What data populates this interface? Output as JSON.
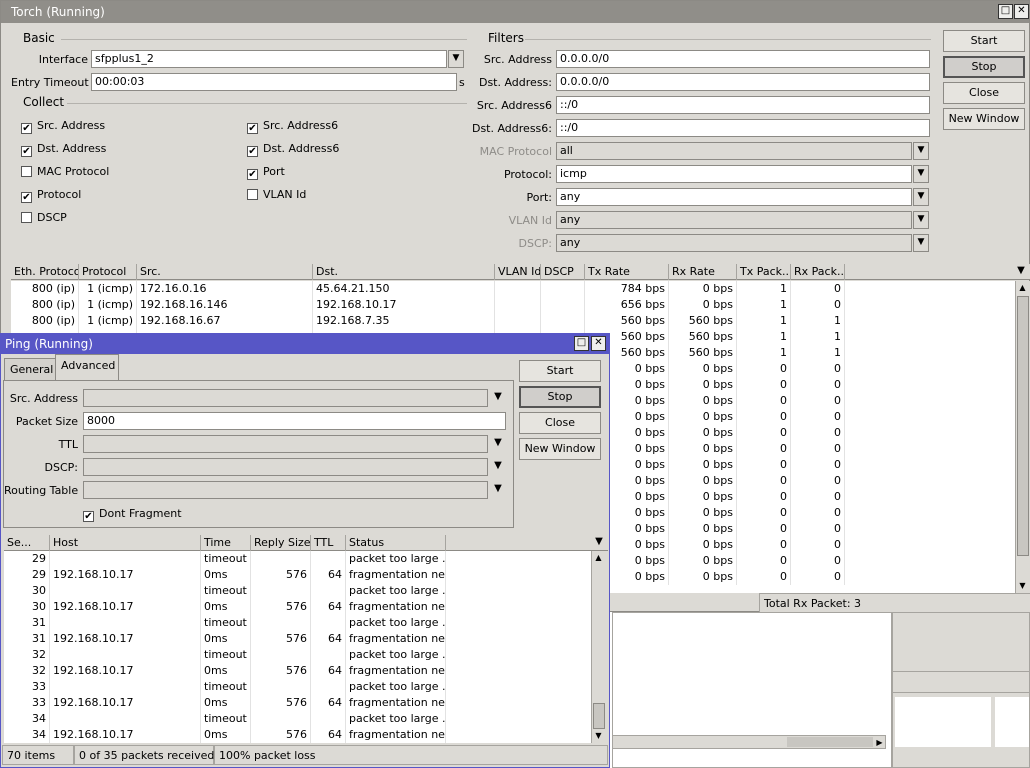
{
  "torch": {
    "title": "Torch (Running)",
    "maximize_glyph": "□",
    "close_glyph": "✕",
    "basic_label": "Basic",
    "interface_label": "Interface",
    "interface_value": "sfpplus1_2",
    "entry_timeout_label": "Entry Timeout",
    "entry_timeout_value": "00:00:03",
    "timeout_unit": "s",
    "collect_label": "Collect",
    "collect": [
      {
        "label": "Src. Address",
        "checked": true
      },
      {
        "label": "Dst. Address",
        "checked": true
      },
      {
        "label": "MAC Protocol",
        "checked": false
      },
      {
        "label": "Protocol",
        "checked": true
      },
      {
        "label": "DSCP",
        "checked": false
      },
      {
        "label": "Src. Address6",
        "checked": true
      },
      {
        "label": "Dst. Address6",
        "checked": true
      },
      {
        "label": "Port",
        "checked": true
      },
      {
        "label": "VLAN Id",
        "checked": false
      }
    ],
    "filters_label": "Filters",
    "filters": [
      {
        "label": "Src. Address",
        "value": "0.0.0.0/0"
      },
      {
        "label": "Dst. Address:",
        "value": "0.0.0.0/0"
      },
      {
        "label": "Src. Address6",
        "value": "::/0"
      },
      {
        "label": "Dst. Address6:",
        "value": "::/0"
      },
      {
        "label": "MAC Protocol",
        "value": "all"
      },
      {
        "label": "Protocol:",
        "value": "icmp"
      },
      {
        "label": "Port:",
        "value": "any"
      },
      {
        "label": "VLAN Id",
        "value": "any"
      },
      {
        "label": "DSCP:",
        "value": "any"
      }
    ],
    "buttons": {
      "start": "Start",
      "stop": "Stop",
      "close": "Close",
      "new_window": "New Window"
    },
    "columns": [
      "Eth. Protocol",
      "Protocol",
      "Src.",
      "Dst.",
      "VLAN Id",
      "DSCP",
      "Tx Rate",
      "Rx Rate",
      "Tx Pack...",
      "Rx Pack..."
    ],
    "rows": [
      [
        "800 (ip)",
        "1 (icmp)",
        "172.16.0.16",
        "45.64.21.150",
        "",
        "",
        "784 bps",
        "0 bps",
        "1",
        "0"
      ],
      [
        "800 (ip)",
        "1 (icmp)",
        "192.168.16.146",
        "192.168.10.17",
        "",
        "",
        "656 bps",
        "0 bps",
        "1",
        "0"
      ],
      [
        "800 (ip)",
        "1 (icmp)",
        "192.168.16.67",
        "192.168.7.35",
        "",
        "",
        "560 bps",
        "560 bps",
        "1",
        "1"
      ],
      [
        "",
        "",
        "",
        "",
        "",
        "",
        "560 bps",
        "560 bps",
        "1",
        "1"
      ],
      [
        "",
        "",
        "",
        "",
        "",
        "",
        "560 bps",
        "560 bps",
        "1",
        "1"
      ],
      [
        "",
        "",
        "",
        "",
        "",
        "",
        "0 bps",
        "0 bps",
        "0",
        "0"
      ],
      [
        "",
        "",
        "",
        "",
        "",
        "",
        "0 bps",
        "0 bps",
        "0",
        "0"
      ],
      [
        "",
        "",
        "",
        "",
        "",
        "",
        "0 bps",
        "0 bps",
        "0",
        "0"
      ],
      [
        "",
        "",
        "",
        "",
        "",
        "",
        "0 bps",
        "0 bps",
        "0",
        "0"
      ],
      [
        "",
        "",
        "",
        "",
        "",
        "",
        "0 bps",
        "0 bps",
        "0",
        "0"
      ],
      [
        "",
        "",
        "",
        "",
        "",
        "",
        "0 bps",
        "0 bps",
        "0",
        "0"
      ],
      [
        "",
        "",
        "",
        "",
        "",
        "",
        "0 bps",
        "0 bps",
        "0",
        "0"
      ],
      [
        "",
        "",
        "",
        "",
        "",
        "",
        "0 bps",
        "0 bps",
        "0",
        "0"
      ],
      [
        "",
        "",
        "",
        "",
        "",
        "",
        "0 bps",
        "0 bps",
        "0",
        "0"
      ],
      [
        "",
        "",
        "",
        "",
        "",
        "",
        "0 bps",
        "0 bps",
        "0",
        "0"
      ],
      [
        "",
        "",
        "",
        "",
        "",
        "",
        "0 bps",
        "0 bps",
        "0",
        "0"
      ],
      [
        "",
        "",
        "",
        "",
        "",
        "",
        "0 bps",
        "0 bps",
        "0",
        "0"
      ],
      [
        "",
        "",
        "",
        "",
        "",
        "",
        "0 bps",
        "0 bps",
        "0",
        "0"
      ],
      [
        "",
        "",
        "",
        "",
        "",
        "",
        "0 bps",
        "0 bps",
        "0",
        "0"
      ]
    ],
    "total_rx": "Total Rx Packet: 3"
  },
  "ping": {
    "title": "Ping (Running)",
    "maximize_glyph": "□",
    "close_glyph": "✕",
    "tabs": [
      "General",
      "Advanced"
    ],
    "active_tab": "Advanced",
    "src_address_label": "Src. Address",
    "src_address_value": "",
    "packet_size_label": "Packet Size",
    "packet_size_value": "8000",
    "ttl_label": "TTL",
    "ttl_value": "",
    "dscp_label": "DSCP:",
    "dscp_value": "",
    "routing_table_label": "Routing Table",
    "routing_table_value": "",
    "dont_fragment_label": "Dont Fragment",
    "dont_fragment_checked": true,
    "buttons": {
      "start": "Start",
      "stop": "Stop",
      "close": "Close",
      "new_window": "New Window"
    },
    "columns": [
      "Se...",
      "Host",
      "Time",
      "Reply Size",
      "TTL",
      "Status"
    ],
    "rows": [
      [
        "29",
        "",
        "timeout",
        "",
        "",
        "packet too large ..."
      ],
      [
        "29",
        "192.168.10.17",
        "0ms",
        "576",
        "64",
        "fragmentation ne..."
      ],
      [
        "30",
        "",
        "timeout",
        "",
        "",
        "packet too large ..."
      ],
      [
        "30",
        "192.168.10.17",
        "0ms",
        "576",
        "64",
        "fragmentation ne..."
      ],
      [
        "31",
        "",
        "timeout",
        "",
        "",
        "packet too large ..."
      ],
      [
        "31",
        "192.168.10.17",
        "0ms",
        "576",
        "64",
        "fragmentation ne..."
      ],
      [
        "32",
        "",
        "timeout",
        "",
        "",
        "packet too large ..."
      ],
      [
        "32",
        "192.168.10.17",
        "0ms",
        "576",
        "64",
        "fragmentation ne..."
      ],
      [
        "33",
        "",
        "timeout",
        "",
        "",
        "packet too large ..."
      ],
      [
        "33",
        "192.168.10.17",
        "0ms",
        "576",
        "64",
        "fragmentation ne..."
      ],
      [
        "34",
        "",
        "timeout",
        "",
        "",
        "packet too large ..."
      ],
      [
        "34",
        "192.168.10.17",
        "0ms",
        "576",
        "64",
        "fragmentation ne..."
      ]
    ],
    "status_items": "70 items",
    "status_received": "0 of 35 packets received",
    "status_loss": "100% packet loss"
  }
}
